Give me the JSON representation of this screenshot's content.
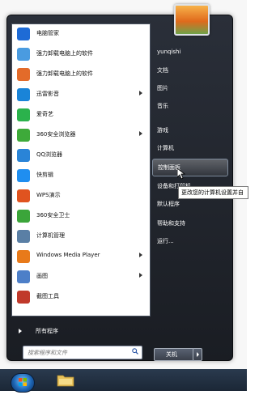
{
  "left_programs": [
    {
      "label": "电脑管家",
      "icon": "pc-manager-icon",
      "color": "#1e6bd6",
      "arrow": false
    },
    {
      "label": "强力卸载电脑上的软件",
      "icon": "uninstall-software-icon",
      "color": "#4a9be0",
      "arrow": false
    },
    {
      "label": "强力卸载电脑上的软件",
      "icon": "uninstall-software-icon",
      "color": "#e36b2a",
      "arrow": false
    },
    {
      "label": "迅雷影音",
      "icon": "xunlei-player-icon",
      "color": "#1a84d8",
      "arrow": true
    },
    {
      "label": "爱奇艺",
      "icon": "iqiyi-icon",
      "color": "#2bb24c",
      "arrow": false
    },
    {
      "label": "360安全浏览器",
      "icon": "360-browser-icon",
      "color": "#3eaa3a",
      "arrow": true
    },
    {
      "label": "QQ浏览器",
      "icon": "qq-browser-icon",
      "color": "#2a84d7",
      "arrow": false
    },
    {
      "label": "快剪辑",
      "icon": "kuaijianji-icon",
      "color": "#1f8ef0",
      "arrow": false
    },
    {
      "label": "WPS演示",
      "icon": "wps-presentation-icon",
      "color": "#e0531f",
      "arrow": false
    },
    {
      "label": "360安全卫士",
      "icon": "360-safeguard-icon",
      "color": "#3ba53a",
      "arrow": false
    },
    {
      "label": "计算机管理",
      "icon": "computer-management-icon",
      "color": "#5a7fa5",
      "arrow": false
    },
    {
      "label": "Windows Media Player",
      "icon": "windows-media-player-icon",
      "color": "#e87a1a",
      "arrow": true
    },
    {
      "label": "画图",
      "icon": "paint-icon",
      "color": "#4d7fc8",
      "arrow": true
    },
    {
      "label": "截图工具",
      "icon": "snipping-tool-icon",
      "color": "#c0392b",
      "arrow": false
    }
  ],
  "all_programs": "所有程序",
  "search": {
    "placeholder": "搜索程序和文件"
  },
  "right_items": [
    {
      "label": "yunqishi",
      "name": "user-name-link"
    },
    {
      "label": "文档",
      "name": "documents-link"
    },
    {
      "label": "图片",
      "name": "pictures-link"
    },
    {
      "label": "音乐",
      "name": "music-link"
    },
    {
      "label": "游戏",
      "name": "games-link"
    },
    {
      "label": "计算机",
      "name": "computer-link"
    },
    {
      "label": "控制面板",
      "name": "control-panel-link"
    },
    {
      "label": "设备和打印机",
      "name": "devices-printers-link"
    },
    {
      "label": "默认程序",
      "name": "default-programs-link"
    },
    {
      "label": "帮助和支持",
      "name": "help-support-link"
    },
    {
      "label": "运行...",
      "name": "run-link"
    }
  ],
  "shutdown_label": "关机",
  "tooltip": "更改您的计算机设置并自"
}
